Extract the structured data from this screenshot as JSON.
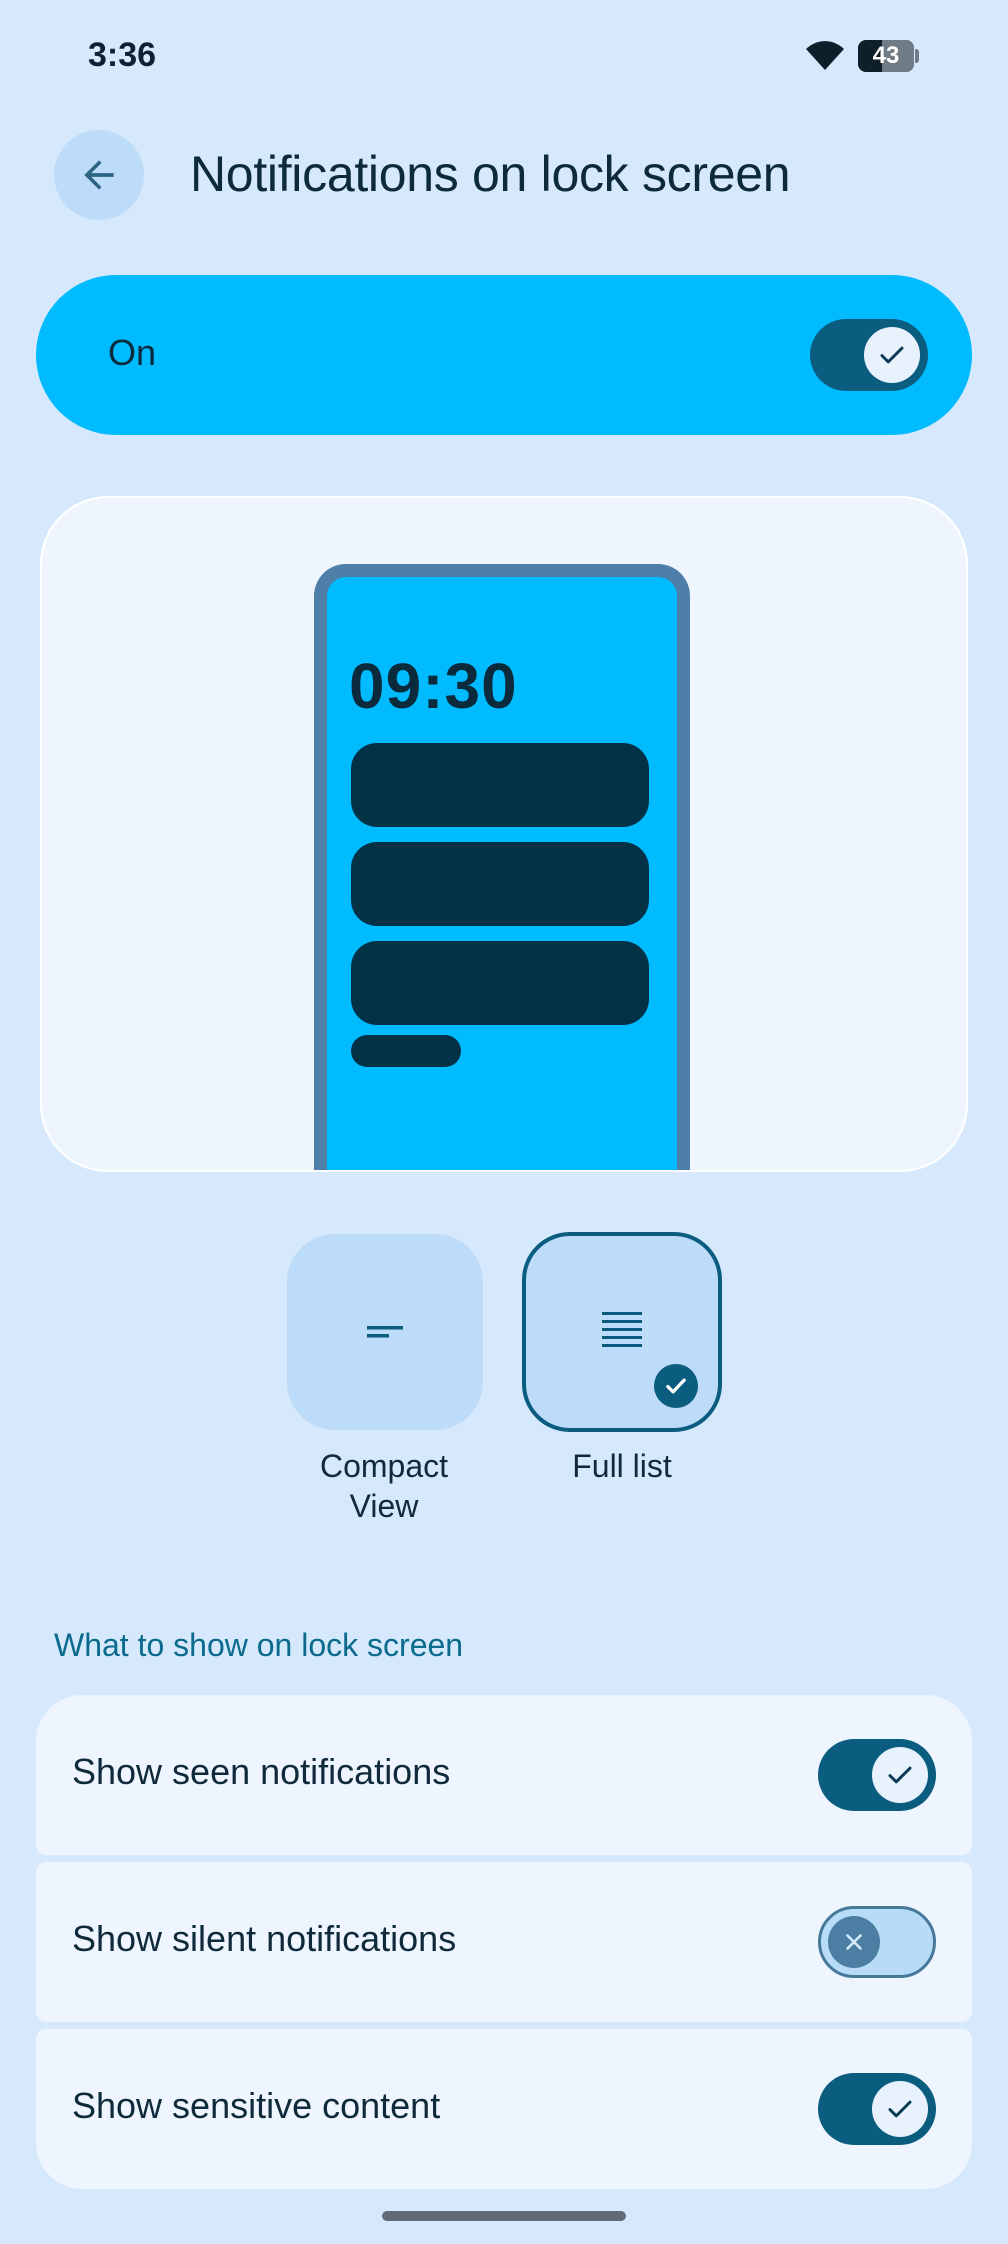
{
  "status_bar": {
    "time": "3:36",
    "battery": "43",
    "battery_percent": 43
  },
  "header": {
    "title": "Notifications on lock screen",
    "back_icon": "arrow-back-icon"
  },
  "master_switch": {
    "label": "On",
    "checked": true
  },
  "preview": {
    "clock": "09:30"
  },
  "style_options": [
    {
      "label": "Compact\nView",
      "icon": "short-lines-icon",
      "selected": false
    },
    {
      "label": "Full list",
      "icon": "list-lines-icon",
      "selected": true
    }
  ],
  "section": {
    "heading": "What to show on lock screen",
    "items": [
      {
        "label": "Show seen notifications",
        "checked": true
      },
      {
        "label": "Show silent notifications",
        "checked": false
      },
      {
        "label": "Show sensitive content",
        "checked": true
      }
    ]
  },
  "colors": {
    "background": "#d6e8fb",
    "accent": "#00bbff",
    "toggle_on": "#0b5d80",
    "card": "#eef5fe",
    "heading": "#0b6b8d"
  }
}
